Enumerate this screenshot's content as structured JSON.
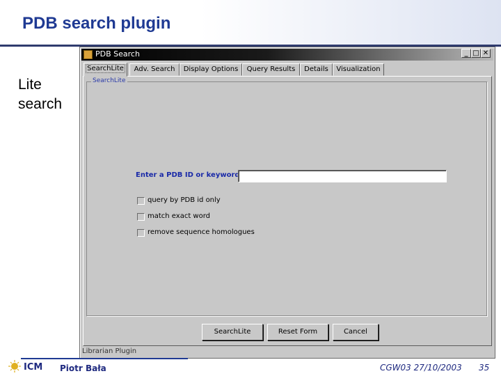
{
  "slide": {
    "title": "PDB search plugin",
    "side_label_line1": "Lite",
    "side_label_line2": "search"
  },
  "window": {
    "title": "PDB Search",
    "controls": {
      "minimize": "_",
      "maximize": "□",
      "close": "✕"
    }
  },
  "tabs": [
    {
      "label": "SearchLite",
      "active": true
    },
    {
      "label": "Adv. Search",
      "active": false
    },
    {
      "label": "Display Options",
      "active": false
    },
    {
      "label": "Query Results",
      "active": false
    },
    {
      "label": "Details",
      "active": false
    },
    {
      "label": "Visualization",
      "active": false
    }
  ],
  "panel": {
    "group_title": "SearchLite",
    "field_label": "Enter a PDB ID or keyword:",
    "field_value": "",
    "options": [
      {
        "label": "query by PDB id only",
        "checked": false
      },
      {
        "label": "match exact word",
        "checked": false
      },
      {
        "label": "remove sequence homologues",
        "checked": false
      }
    ],
    "buttons": {
      "search": "SearchLite",
      "reset": "Reset Form",
      "cancel": "Cancel"
    }
  },
  "statusbar": {
    "text": "Librarian Plugin"
  },
  "footer": {
    "logo_text": "ICM",
    "author": "Piotr Bała",
    "event": "CGW03 27/10/2003",
    "page": "35"
  },
  "colors": {
    "title_blue": "#1f3a93",
    "label_blue": "#1a2aa8",
    "window_gray": "#c8c8c8"
  }
}
